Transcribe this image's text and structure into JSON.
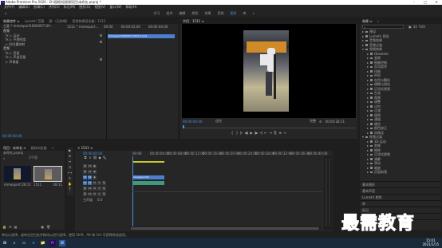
{
  "titlebar": {
    "logo": "Pr",
    "title": "Adobe Premiere Pro 2020 - D:\\视频\\短视频项目\\未命名.prproj *",
    "minimize": "–",
    "maximize": "□",
    "close": "✕"
  },
  "menu": [
    "文件(F)",
    "编辑(E)",
    "剪辑(C)",
    "序列(S)",
    "标记(M)",
    "图形(G)",
    "视图(V)",
    "窗口(W)",
    "帮助(H)"
  ],
  "workspaces": {
    "home": "⌂",
    "items": [
      "学习",
      "组件",
      "编辑",
      "颜色",
      "效果",
      "音频",
      "图形",
      "库",
      "»"
    ],
    "active_index": 6
  },
  "source_panel": {
    "tabs": [
      "效果控件 ≡",
      "Lumetri 范围",
      "源：(无剪辑)",
      "音频剪辑混合器：1511"
    ],
    "active_tab": 0,
    "breadcrumb": "主要 * mmexport1600097139…",
    "seq_link": "1511 * mmexport…",
    "section_video": "视频",
    "items": [
      "fx ▷ 运动",
      "fx ▷ 不透明度",
      "▷ 时间重映射",
      "音频",
      "fx ▷ 音量",
      "fx ▷ 声道音量",
      "▷ 声像器"
    ],
    "mini_ruler_start": "00:00",
    "mini_ruler_mid": "00:00:02:00",
    "mini_ruler_end": "00:00:04:00",
    "mini_clip": "mmexport1600097139172.mp4",
    "timecode": "00:00:00:00"
  },
  "program_monitor": {
    "tab_label": "节目：1511 ≡",
    "timecode": "00:00:00:00",
    "fit": "适合",
    "quality": "完整",
    "duration": "00:00:28:11",
    "controls": [
      "{",
      "}",
      "|←",
      "◀|",
      "▶",
      "|▶",
      "→|",
      "⇤",
      "⇥",
      "⎘",
      "⊞",
      "+"
    ]
  },
  "project_panel": {
    "tabs": [
      "项目：未命名 ≡",
      "媒体浏览器",
      "»"
    ],
    "path": "未命名.prproj",
    "count": "2个项",
    "items": [
      {
        "name": "mmexport1600097139172...",
        "duration": "28:11"
      },
      {
        "name": "1511",
        "duration": "28:11"
      }
    ]
  },
  "tools": [
    "▶",
    "⇹",
    "↔",
    "⇶",
    "⟷",
    "✎",
    "✋",
    "T"
  ],
  "timeline": {
    "tab_label": "× 1511 ≡",
    "timecode": "00:00:00:00",
    "ruler": [
      "00:00",
      "00:00:04:00",
      "00:00:08:00",
      "00:00:12:00",
      "00:00:16:00",
      "00:00:20:00",
      "00:00:24:00",
      "00:00:28:00",
      "00:00:32:00",
      "00:00:36:00",
      "00:00:40:00",
      "00:00:44:00",
      "00:00:48:00"
    ],
    "tracks": [
      {
        "name": "V3"
      },
      {
        "name": "V2"
      },
      {
        "name": "V1"
      },
      {
        "name": "A1"
      },
      {
        "name": "A2"
      },
      {
        "name": "A3"
      }
    ],
    "master": "主声道",
    "master_value": "0.0",
    "video_clip": "mmexport16",
    "audio_clip": "",
    "colors": {
      "video_clip": "#4d7fd1",
      "audio_clip": "#3f9a7c",
      "selection": "#3a6fb0"
    }
  },
  "effects_panel": {
    "tabs": [
      "效果 ≡",
      "»"
    ],
    "search_value": "",
    "tree": [
      {
        "label": "预设",
        "level": 0,
        "type": "folder"
      },
      {
        "label": "Lumetri 预设",
        "level": 0,
        "type": "folder"
      },
      {
        "label": "音频效果",
        "level": 0,
        "type": "folder"
      },
      {
        "label": "音频过渡",
        "level": 0,
        "type": "folder"
      },
      {
        "label": "视频效果",
        "level": 0,
        "type": "folder",
        "open": true
      },
      {
        "label": "Obsolete",
        "level": 1,
        "type": "folder"
      },
      {
        "label": "变换",
        "level": 1,
        "type": "folder"
      },
      {
        "label": "图像控制",
        "level": 1,
        "type": "folder"
      },
      {
        "label": "实用程序",
        "level": 1,
        "type": "folder"
      },
      {
        "label": "扭曲",
        "level": 1,
        "type": "folder"
      },
      {
        "label": "时间",
        "level": 1,
        "type": "folder"
      },
      {
        "label": "杂色与颗粒",
        "level": 1,
        "type": "folder"
      },
      {
        "label": "模糊与锐化",
        "level": 1,
        "type": "folder"
      },
      {
        "label": "沉浸式视频",
        "level": 1,
        "type": "folder"
      },
      {
        "label": "生成",
        "level": 1,
        "type": "folder"
      },
      {
        "label": "视频",
        "level": 1,
        "type": "folder"
      },
      {
        "label": "调整",
        "level": 1,
        "type": "folder"
      },
      {
        "label": "过时",
        "level": 1,
        "type": "folder"
      },
      {
        "label": "过渡",
        "level": 1,
        "type": "folder"
      },
      {
        "label": "透视",
        "level": 1,
        "type": "folder"
      },
      {
        "label": "通道",
        "level": 1,
        "type": "folder"
      },
      {
        "label": "键控",
        "level": 1,
        "type": "folder"
      },
      {
        "label": "颜色校正",
        "level": 1,
        "type": "folder"
      },
      {
        "label": "风格化",
        "level": 1,
        "type": "folder"
      },
      {
        "label": "视频过渡",
        "level": 0,
        "type": "folder",
        "open": true
      },
      {
        "label": "3D 运动",
        "level": 1,
        "type": "folder"
      },
      {
        "label": "划像",
        "level": 1,
        "type": "folder"
      },
      {
        "label": "擦除",
        "level": 1,
        "type": "folder"
      },
      {
        "label": "沉浸式视频",
        "level": 1,
        "type": "folder"
      },
      {
        "label": "溶解",
        "level": 1,
        "type": "folder"
      },
      {
        "label": "滑动",
        "level": 1,
        "type": "folder"
      },
      {
        "label": "缩放",
        "level": 1,
        "type": "folder"
      },
      {
        "label": "页面剥落",
        "level": 1,
        "type": "folder"
      }
    ],
    "sections": [
      "基本图形",
      "基本声音",
      "Lumetri 颜色",
      "库",
      "标记",
      "历史记录",
      "信息"
    ]
  },
  "status": "单击以选择，或单击空白处并拖动以进行选择。使用 Shift、Alt 和 Ctrl 可获得其他选项。",
  "taskbar": {
    "start": "⊞",
    "apps": [
      "⌕",
      "▭",
      "e",
      "📁",
      "Pr",
      "W"
    ],
    "time": "15:01",
    "date": "2021/1/15"
  },
  "watermark": "最需教育"
}
